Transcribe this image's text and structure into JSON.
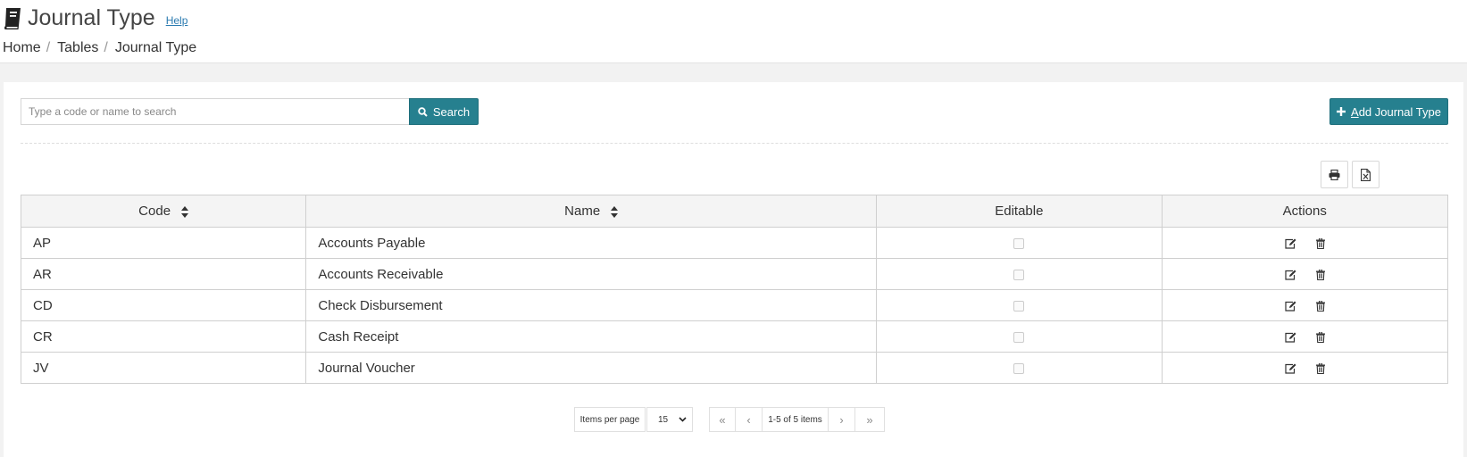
{
  "header": {
    "title": "Journal Type",
    "help_label": "Help",
    "breadcrumb": [
      "Home",
      "Tables",
      "Journal Type"
    ]
  },
  "toolbar": {
    "search_placeholder": "Type a code or name to search",
    "search_label": "Search",
    "add_label_first": "A",
    "add_label_rest": "dd Journal Type"
  },
  "table": {
    "columns": [
      "Code",
      "Name",
      "Editable",
      "Actions"
    ],
    "rows": [
      {
        "code": "AP",
        "name": "Accounts Payable",
        "editable": false
      },
      {
        "code": "AR",
        "name": "Accounts Receivable",
        "editable": false
      },
      {
        "code": "CD",
        "name": "Check Disbursement",
        "editable": false
      },
      {
        "code": "CR",
        "name": "Cash Receipt",
        "editable": false
      },
      {
        "code": "JV",
        "name": "Journal Voucher",
        "editable": false
      }
    ]
  },
  "pagination": {
    "items_per_page_label": "Items per page",
    "page_size": "15",
    "range_text": "1-5 of 5 items",
    "first": "«",
    "prev": "‹",
    "next": "›",
    "last": "»"
  },
  "colors": {
    "accent": "#26808f"
  }
}
